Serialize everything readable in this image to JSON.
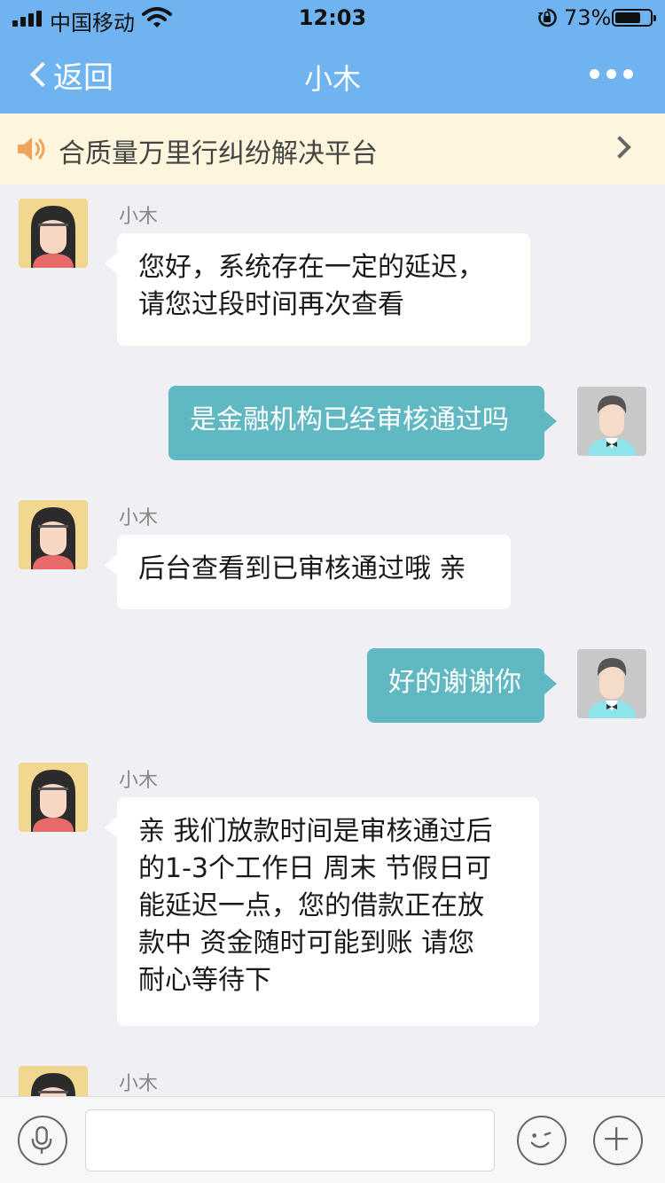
{
  "status_bar": {
    "carrier": "中国移动",
    "time": "12:03",
    "battery_percent": "73%",
    "battery_level": 0.73
  },
  "nav": {
    "back_label": "返回",
    "title": "小木"
  },
  "notice": {
    "text": "合质量万里行纠纷解决平台"
  },
  "messages": [
    {
      "from": "agent",
      "sender": "小木",
      "text": "您好，系统存在一定的延迟，\n请您过段时间再次查看"
    },
    {
      "from": "user",
      "text": "是金融机构已经审核通过吗"
    },
    {
      "from": "agent",
      "sender": "小木",
      "text": "后台查看到已审核通过哦 亲"
    },
    {
      "from": "user",
      "text": "好的谢谢你"
    },
    {
      "from": "agent",
      "sender": "小木",
      "text": "亲 我们放款时间是审核通过后\n的1-3个工作日 周末 节假日可\n能延迟一点，您的借款正在放\n款中 资金随时可能到账 请您\n耐心等待下"
    },
    {
      "from": "agent",
      "sender": "小木",
      "text": ""
    }
  ],
  "input": {
    "placeholder": ""
  },
  "colors": {
    "nav_bg": "#6fb3f0",
    "notice_bg": "#fdf5dc",
    "outgoing_bubble": "#5fb8c2",
    "incoming_bubble": "#ffffff",
    "chat_bg": "#efeff4"
  },
  "icons": [
    "signal-icon",
    "wifi-icon",
    "orientation-lock-icon",
    "battery-icon",
    "back-chevron-icon",
    "more-icon",
    "speaker-icon",
    "chevron-right-icon",
    "microphone-icon",
    "emoji-icon",
    "plus-icon"
  ]
}
